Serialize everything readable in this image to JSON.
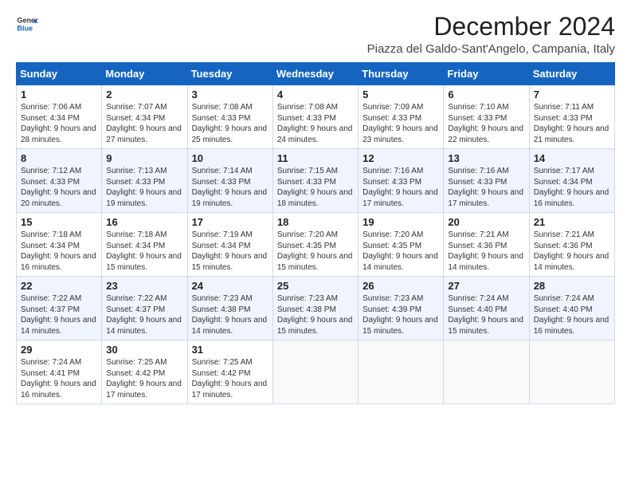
{
  "logo": {
    "line1": "General",
    "line2": "Blue",
    "icon_color": "#1565c0"
  },
  "title": "December 2024",
  "subtitle": "Piazza del Galdo-Sant'Angelo, Campania, Italy",
  "days_of_week": [
    "Sunday",
    "Monday",
    "Tuesday",
    "Wednesday",
    "Thursday",
    "Friday",
    "Saturday"
  ],
  "weeks": [
    [
      {
        "day": "1",
        "sunrise": "Sunrise: 7:06 AM",
        "sunset": "Sunset: 4:34 PM",
        "daylight": "Daylight: 9 hours and 28 minutes."
      },
      {
        "day": "2",
        "sunrise": "Sunrise: 7:07 AM",
        "sunset": "Sunset: 4:34 PM",
        "daylight": "Daylight: 9 hours and 27 minutes."
      },
      {
        "day": "3",
        "sunrise": "Sunrise: 7:08 AM",
        "sunset": "Sunset: 4:33 PM",
        "daylight": "Daylight: 9 hours and 25 minutes."
      },
      {
        "day": "4",
        "sunrise": "Sunrise: 7:08 AM",
        "sunset": "Sunset: 4:33 PM",
        "daylight": "Daylight: 9 hours and 24 minutes."
      },
      {
        "day": "5",
        "sunrise": "Sunrise: 7:09 AM",
        "sunset": "Sunset: 4:33 PM",
        "daylight": "Daylight: 9 hours and 23 minutes."
      },
      {
        "day": "6",
        "sunrise": "Sunrise: 7:10 AM",
        "sunset": "Sunset: 4:33 PM",
        "daylight": "Daylight: 9 hours and 22 minutes."
      },
      {
        "day": "7",
        "sunrise": "Sunrise: 7:11 AM",
        "sunset": "Sunset: 4:33 PM",
        "daylight": "Daylight: 9 hours and 21 minutes."
      }
    ],
    [
      {
        "day": "8",
        "sunrise": "Sunrise: 7:12 AM",
        "sunset": "Sunset: 4:33 PM",
        "daylight": "Daylight: 9 hours and 20 minutes."
      },
      {
        "day": "9",
        "sunrise": "Sunrise: 7:13 AM",
        "sunset": "Sunset: 4:33 PM",
        "daylight": "Daylight: 9 hours and 19 minutes."
      },
      {
        "day": "10",
        "sunrise": "Sunrise: 7:14 AM",
        "sunset": "Sunset: 4:33 PM",
        "daylight": "Daylight: 9 hours and 19 minutes."
      },
      {
        "day": "11",
        "sunrise": "Sunrise: 7:15 AM",
        "sunset": "Sunset: 4:33 PM",
        "daylight": "Daylight: 9 hours and 18 minutes."
      },
      {
        "day": "12",
        "sunrise": "Sunrise: 7:16 AM",
        "sunset": "Sunset: 4:33 PM",
        "daylight": "Daylight: 9 hours and 17 minutes."
      },
      {
        "day": "13",
        "sunrise": "Sunrise: 7:16 AM",
        "sunset": "Sunset: 4:33 PM",
        "daylight": "Daylight: 9 hours and 17 minutes."
      },
      {
        "day": "14",
        "sunrise": "Sunrise: 7:17 AM",
        "sunset": "Sunset: 4:34 PM",
        "daylight": "Daylight: 9 hours and 16 minutes."
      }
    ],
    [
      {
        "day": "15",
        "sunrise": "Sunrise: 7:18 AM",
        "sunset": "Sunset: 4:34 PM",
        "daylight": "Daylight: 9 hours and 16 minutes."
      },
      {
        "day": "16",
        "sunrise": "Sunrise: 7:18 AM",
        "sunset": "Sunset: 4:34 PM",
        "daylight": "Daylight: 9 hours and 15 minutes."
      },
      {
        "day": "17",
        "sunrise": "Sunrise: 7:19 AM",
        "sunset": "Sunset: 4:34 PM",
        "daylight": "Daylight: 9 hours and 15 minutes."
      },
      {
        "day": "18",
        "sunrise": "Sunrise: 7:20 AM",
        "sunset": "Sunset: 4:35 PM",
        "daylight": "Daylight: 9 hours and 15 minutes."
      },
      {
        "day": "19",
        "sunrise": "Sunrise: 7:20 AM",
        "sunset": "Sunset: 4:35 PM",
        "daylight": "Daylight: 9 hours and 14 minutes."
      },
      {
        "day": "20",
        "sunrise": "Sunrise: 7:21 AM",
        "sunset": "Sunset: 4:36 PM",
        "daylight": "Daylight: 9 hours and 14 minutes."
      },
      {
        "day": "21",
        "sunrise": "Sunrise: 7:21 AM",
        "sunset": "Sunset: 4:36 PM",
        "daylight": "Daylight: 9 hours and 14 minutes."
      }
    ],
    [
      {
        "day": "22",
        "sunrise": "Sunrise: 7:22 AM",
        "sunset": "Sunset: 4:37 PM",
        "daylight": "Daylight: 9 hours and 14 minutes."
      },
      {
        "day": "23",
        "sunrise": "Sunrise: 7:22 AM",
        "sunset": "Sunset: 4:37 PM",
        "daylight": "Daylight: 9 hours and 14 minutes."
      },
      {
        "day": "24",
        "sunrise": "Sunrise: 7:23 AM",
        "sunset": "Sunset: 4:38 PM",
        "daylight": "Daylight: 9 hours and 14 minutes."
      },
      {
        "day": "25",
        "sunrise": "Sunrise: 7:23 AM",
        "sunset": "Sunset: 4:38 PM",
        "daylight": "Daylight: 9 hours and 15 minutes."
      },
      {
        "day": "26",
        "sunrise": "Sunrise: 7:23 AM",
        "sunset": "Sunset: 4:39 PM",
        "daylight": "Daylight: 9 hours and 15 minutes."
      },
      {
        "day": "27",
        "sunrise": "Sunrise: 7:24 AM",
        "sunset": "Sunset: 4:40 PM",
        "daylight": "Daylight: 9 hours and 15 minutes."
      },
      {
        "day": "28",
        "sunrise": "Sunrise: 7:24 AM",
        "sunset": "Sunset: 4:40 PM",
        "daylight": "Daylight: 9 hours and 16 minutes."
      }
    ],
    [
      {
        "day": "29",
        "sunrise": "Sunrise: 7:24 AM",
        "sunset": "Sunset: 4:41 PM",
        "daylight": "Daylight: 9 hours and 16 minutes."
      },
      {
        "day": "30",
        "sunrise": "Sunrise: 7:25 AM",
        "sunset": "Sunset: 4:42 PM",
        "daylight": "Daylight: 9 hours and 17 minutes."
      },
      {
        "day": "31",
        "sunrise": "Sunrise: 7:25 AM",
        "sunset": "Sunset: 4:42 PM",
        "daylight": "Daylight: 9 hours and 17 minutes."
      },
      null,
      null,
      null,
      null
    ]
  ]
}
